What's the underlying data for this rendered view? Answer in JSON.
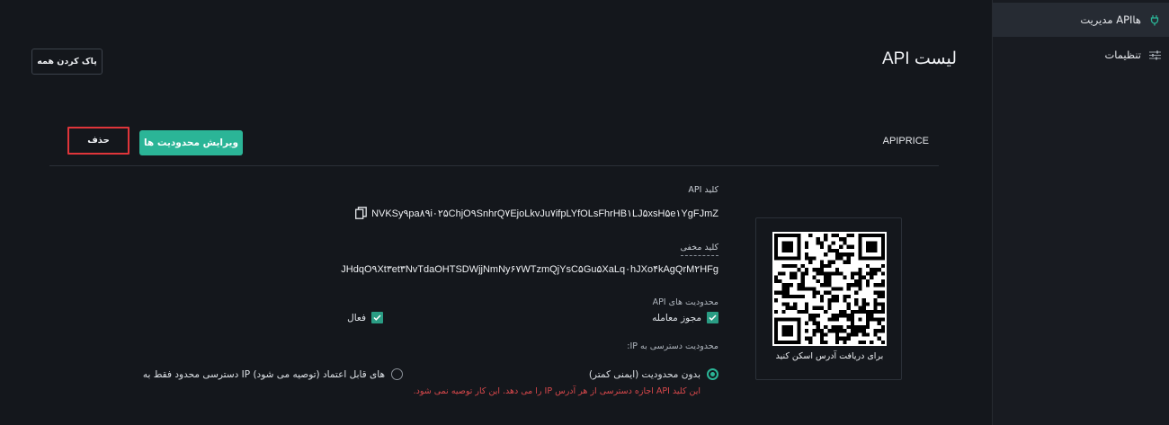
{
  "sidebar": {
    "items": [
      {
        "label": "مدیریت APIها",
        "icon": "plug-icon",
        "active": true
      },
      {
        "label": "تنظیمات",
        "icon": "sliders-icon",
        "active": false
      }
    ]
  },
  "header": {
    "title": "لیست API",
    "clear_all_label": "پاک کردن همه"
  },
  "api": {
    "name": "APIPRICE",
    "edit_label": "ویرایش محدودیت ها",
    "delete_label": "حذف",
    "api_key_label": "کلید API",
    "api_key_value": "NVKSy۹pa۸۹i۰۲۵ChjO۹SnhrQ۷EjoLkvJu۷ifpLYfOLsFhrHB۱LJ۵xsH۵e۱YgFJmZ",
    "secret_key_label": "کلید مخفی",
    "secret_key_value": "JHdqO۹Xt۳et۳NvTdaOHTSDWjjNmNy۶۷WTzmQjYsC۵Gu۵XaLq۰hJXo۴kAgQrM۲HFg",
    "limits_label": "محدودیت های API",
    "trade_permission_label": "مجوز معامله",
    "active_label": "فعال",
    "ip_label": "محدودیت دسترسی به IP:",
    "unrestricted_label": "بدون محدودیت (ایمنی کمتر)",
    "restricted_label": "دسترسی محدود فقط به IP های قابل اعتماد (توصیه می شود)",
    "warning_text": "این کلید API اجازه دسترسی از هر آدرس IP را می دهد. این کار توصیه نمی شود.",
    "qr_caption": "برای دریافت آدرس اسکن کنید"
  },
  "colors": {
    "accent": "#2bb597",
    "danger": "#e0353a",
    "background": "#14171c"
  }
}
